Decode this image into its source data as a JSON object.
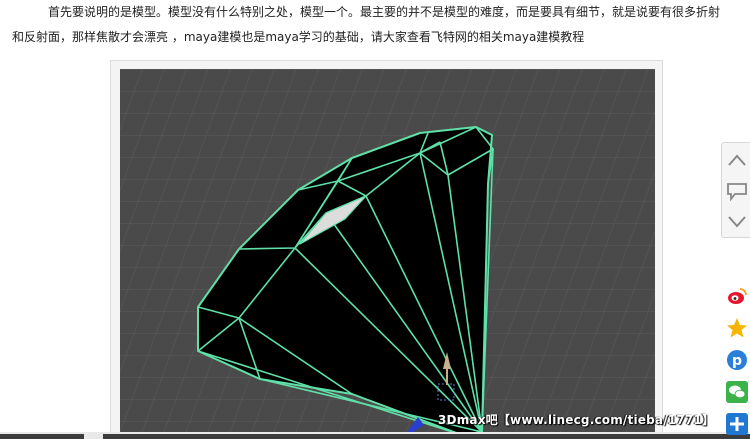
{
  "article": {
    "line1": "首先要说明的是模型。模型没有什么特别之处，模型一个。最主要的并不是模型的难度，而是要具有细节，就是说要有很多折射",
    "line2": "和反射面，那样焦散才会漂亮 ，maya建模也是maya学习的基础，请大家查看飞特网的相关maya建模教程"
  },
  "figure": {
    "watermark": "3Dmax吧【www.linecg.com/tieba/1771】"
  },
  "colors": {
    "wireframe": "#5fe0a8",
    "viewport_bg": "#4a4a4a",
    "grid": "#5a5a5a"
  },
  "side_nav": {
    "icons": [
      "chevron-up-icon",
      "comment-icon",
      "chevron-down-icon"
    ]
  },
  "share": {
    "icons": [
      "weibo-icon",
      "qzone-star-icon",
      "pinterest-icon",
      "wechat-icon",
      "plus-icon"
    ]
  }
}
